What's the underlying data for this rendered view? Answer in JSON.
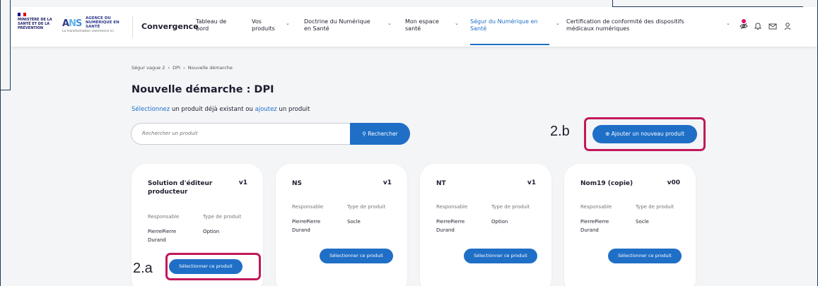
{
  "header": {
    "ministry_logo": "MINISTÈRE DE LA SANTÉ ET DE LA PRÉVENTION",
    "ans_logo": "AGENCE DU NUMÉRIQUE EN SANTÉ",
    "ans_tagline": "La transformation commence ici",
    "brand": "Convergence",
    "nav": [
      {
        "label": "Tableau de bord"
      },
      {
        "label": "Vos produits"
      },
      {
        "label": "Doctrine du Numérique en Santé"
      },
      {
        "label": "Mon espace santé"
      },
      {
        "label": "Ségur du Numérique en Santé"
      },
      {
        "label": "Certification de conformité des dispositifs médicaux numériques"
      }
    ],
    "icons": [
      "eye-off-icon",
      "bell-icon",
      "mail-icon",
      "user-icon"
    ]
  },
  "breadcrumb": [
    "Ségur vague 2",
    "DPI",
    "Nouvelle démarche"
  ],
  "title": "Nouvelle démarche : DPI",
  "subtitle": {
    "link1": "Sélectionnez",
    "text1": "un produit déjà existant ou",
    "link2": "ajoutez",
    "text2": "un produit"
  },
  "search": {
    "placeholder": "Rechercher un produit",
    "button": "Rechercher"
  },
  "add_button": "Ajouter un nouveau produit",
  "annotations": {
    "a": "2.a",
    "b": "2.b"
  },
  "labels": {
    "responsable": "Responsable",
    "type": "Type de produit",
    "select": "Sélectionner ce produit"
  },
  "cards": [
    {
      "name": "Solution d'éditeur producteur",
      "version": "v1",
      "responsable": "PierrePierre Durand",
      "type": "Option"
    },
    {
      "name": "NS",
      "version": "v1",
      "responsable": "PierrePierre Durand",
      "type": "Socle"
    },
    {
      "name": "NT",
      "version": "v1",
      "responsable": "PierrePierre Durand",
      "type": "Option"
    },
    {
      "name": "Nom19 (copie)",
      "version": "v00",
      "responsable": "PierrePierre Durand",
      "type": "Socle"
    }
  ],
  "colors": {
    "primary": "#1f6fc7",
    "highlight": "#c2185b"
  }
}
